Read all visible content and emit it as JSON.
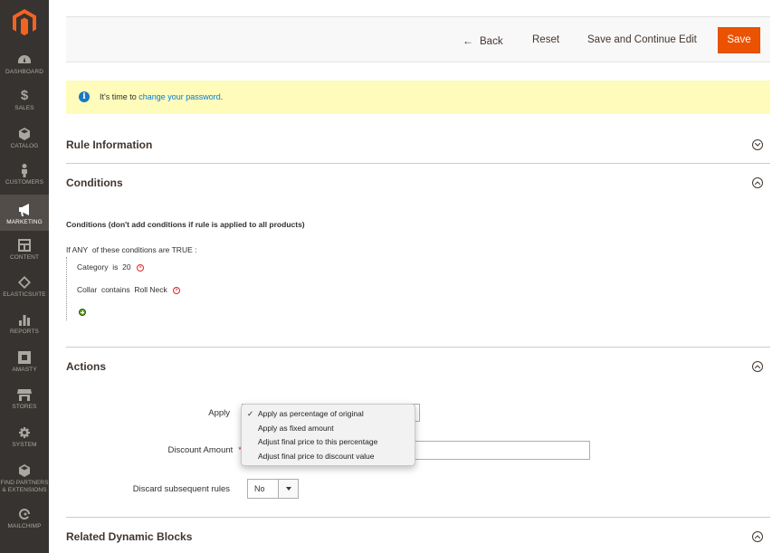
{
  "sidebar": {
    "items": [
      {
        "label": "DASHBOARD",
        "icon": "dashboard-icon"
      },
      {
        "label": "SALES",
        "icon": "dollar-icon"
      },
      {
        "label": "CATALOG",
        "icon": "cube-icon"
      },
      {
        "label": "CUSTOMERS",
        "icon": "person-icon"
      },
      {
        "label": "MARKETING",
        "icon": "megaphone-icon",
        "active": true
      },
      {
        "label": "CONTENT",
        "icon": "layout-icon"
      },
      {
        "label": "ELASTICSUITE",
        "icon": "elasticsuite-icon"
      },
      {
        "label": "REPORTS",
        "icon": "bar-chart-icon"
      },
      {
        "label": "AMASTY",
        "icon": "amasty-icon"
      },
      {
        "label": "STORES",
        "icon": "store-icon"
      },
      {
        "label": "SYSTEM",
        "icon": "gear-icon"
      },
      {
        "label": "FIND PARTNERS & EXTENSIONS",
        "icon": "partners-icon"
      },
      {
        "label": "MAILCHIMP",
        "icon": "mailchimp-icon"
      }
    ]
  },
  "toolbar": {
    "back_label": "Back",
    "reset_label": "Reset",
    "save_continue_label": "Save and Continue Edit",
    "save_label": "Save"
  },
  "notice": {
    "prefix": "It's time to ",
    "link": "change your password",
    "suffix": "."
  },
  "sections": {
    "rule_information": "Rule Information",
    "conditions": "Conditions",
    "actions": "Actions",
    "related_blocks": "Related Dynamic Blocks"
  },
  "conditions": {
    "heading": "Conditions (don't add conditions if rule is applied to all products)",
    "if_prefix": "If",
    "if_any": "ANY",
    "if_middle": "of these conditions are",
    "if_true": "TRUE",
    "if_suffix": ":",
    "rows": [
      {
        "attribute": "Category",
        "operator": "is",
        "value": "20"
      },
      {
        "attribute": "Collar",
        "operator": "contains",
        "value": "Roll Neck"
      }
    ]
  },
  "actions": {
    "apply_label": "Apply",
    "apply_options": [
      {
        "label": "Apply as percentage of original",
        "selected": true
      },
      {
        "label": "Apply as fixed amount",
        "selected": false
      },
      {
        "label": "Adjust final price to this percentage",
        "selected": false
      },
      {
        "label": "Adjust final price to discount value",
        "selected": false
      }
    ],
    "discount_amount_label": "Discount Amount",
    "discount_amount_required": "*",
    "discount_amount_value": "",
    "discard_label": "Discard subsequent rules",
    "discard_value": "No"
  },
  "colors": {
    "sidebar_bg": "#373330",
    "save_button": "#eb5202",
    "notice_bg": "#fffbbb",
    "link": "#007bdb"
  }
}
